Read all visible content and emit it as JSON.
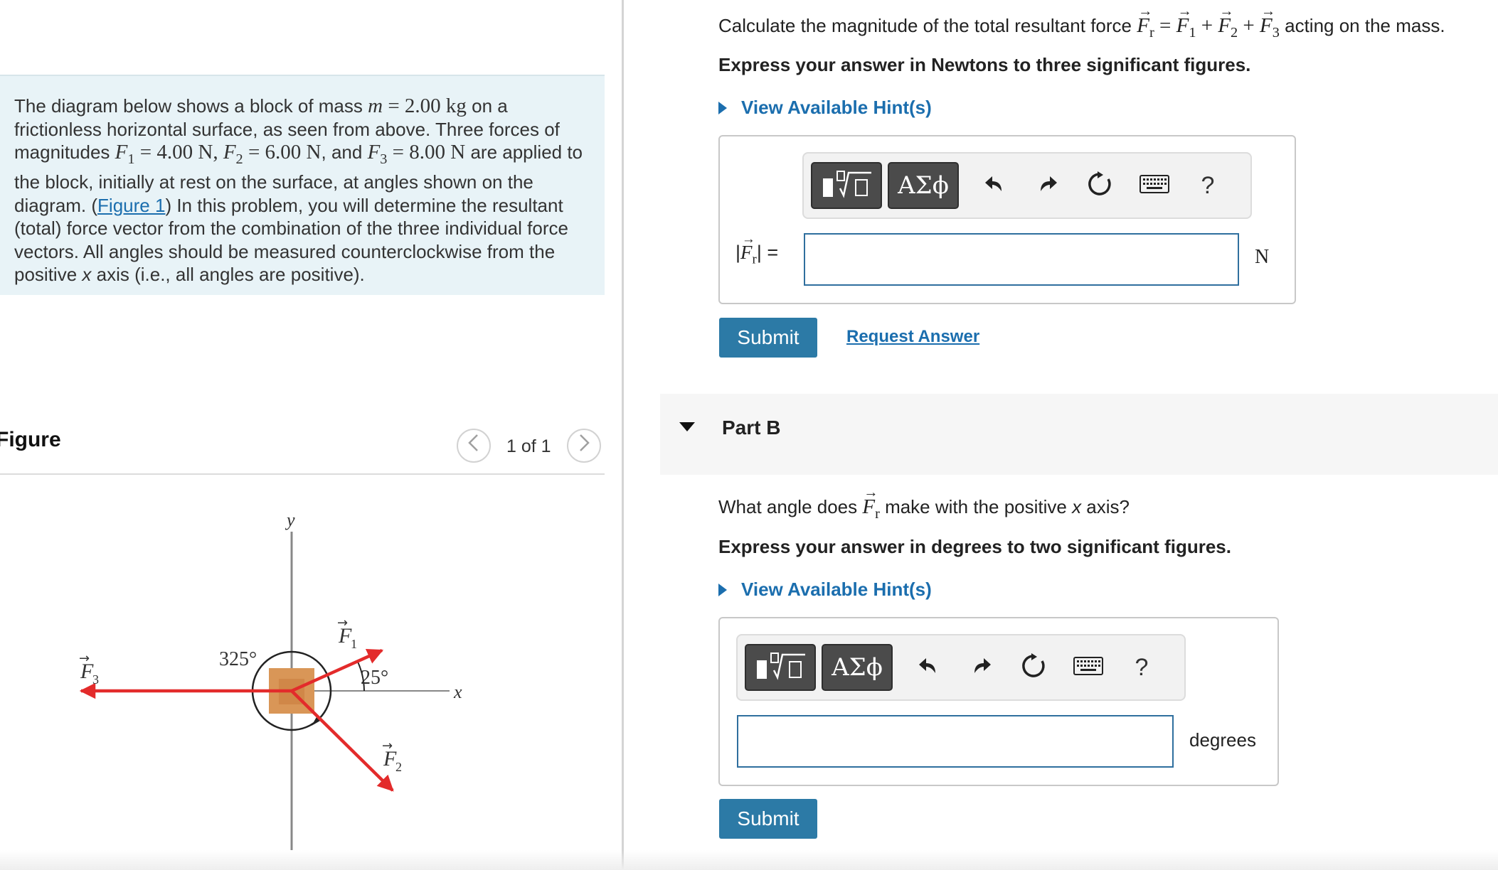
{
  "intro": {
    "text_before_m": "The diagram below shows a block of mass ",
    "mass_symbol": "m",
    "mass_value": " = 2.00 kg",
    "text_after_m": " on a frictionless horizontal surface, as seen from above. Three forces of magnitudes ",
    "f1_symbol": "F",
    "f1_sub": "1",
    "f1_value": " = 4.00 N, ",
    "f2_symbol": "F",
    "f2_sub": "2",
    "f2_value": " = 6.00 N",
    "and_text": ", and ",
    "f3_symbol": "F",
    "f3_sub": "3",
    "f3_value": " = 8.00 N",
    "text_after_forces": " are applied to the block, initially at rest on the surface, at angles shown on the diagram. (",
    "figure_link": "Figure 1",
    "text_after_link": ") In this problem, you will determine the resultant (total) force vector from the combination of the three individual force vectors. All angles should be measured counterclockwise from the positive ",
    "x_axis": "x",
    "text_end": " axis (i.e., all angles are positive)."
  },
  "figure_panel": {
    "title": "Figure",
    "pager_text": "1 of 1",
    "prev_icon": "chevron-left-icon",
    "next_icon": "chevron-right-icon"
  },
  "diagram": {
    "y_axis_label": "y",
    "x_axis_label": "x",
    "f1_label": "F",
    "f1_sub": "1",
    "f2_label": "F",
    "f2_sub": "2",
    "f3_label": "F",
    "f3_sub": "3",
    "angle_325": "325°",
    "angle_25": "25°",
    "force_color": "#e32b2b",
    "block_color": "#d99657"
  },
  "partA": {
    "question_before": "Calculate the magnitude of the total resultant force ",
    "fr_symbol": "F",
    "fr_sub": "r",
    "eq_sign": " = ",
    "f1_symbol": "F",
    "f1_sub": "1",
    "plus1": " + ",
    "f2_symbol": "F",
    "f2_sub": "2",
    "plus2": " + ",
    "f3_symbol": "F",
    "f3_sub": "3",
    "question_after": " acting on the mass.",
    "instruction": "Express your answer in Newtons to three significant figures.",
    "hint_label": "View Available Hint(s)",
    "answer_label_prefix": "|",
    "answer_label_symbol": "F",
    "answer_label_sub": "r",
    "answer_label_suffix": "| =",
    "answer_value": "",
    "unit": "N",
    "submit_label": "Submit",
    "request_answer_label": "Request Answer"
  },
  "partB": {
    "title": "Part B",
    "question_before": "What angle does ",
    "fr_symbol": "F",
    "fr_sub": "r",
    "question_middle": " make with the positive ",
    "x_axis": "x",
    "question_after": " axis?",
    "instruction": "Express your answer in degrees to two significant figures.",
    "hint_label": "View Available Hint(s)",
    "answer_value": "",
    "unit": "degrees",
    "submit_label": "Submit"
  },
  "toolbar": {
    "greek_label": "ΑΣϕ",
    "help_label": "?",
    "icons": [
      "templates-icon",
      "greek-symbols-icon",
      "undo-icon",
      "redo-icon",
      "reset-icon",
      "keyboard-icon",
      "help-icon"
    ]
  },
  "colors": {
    "accent": "#1b6eae",
    "submit_bg": "#2c7aa6",
    "intro_bg": "#e8f3f7",
    "input_border": "#2f6f9e"
  }
}
